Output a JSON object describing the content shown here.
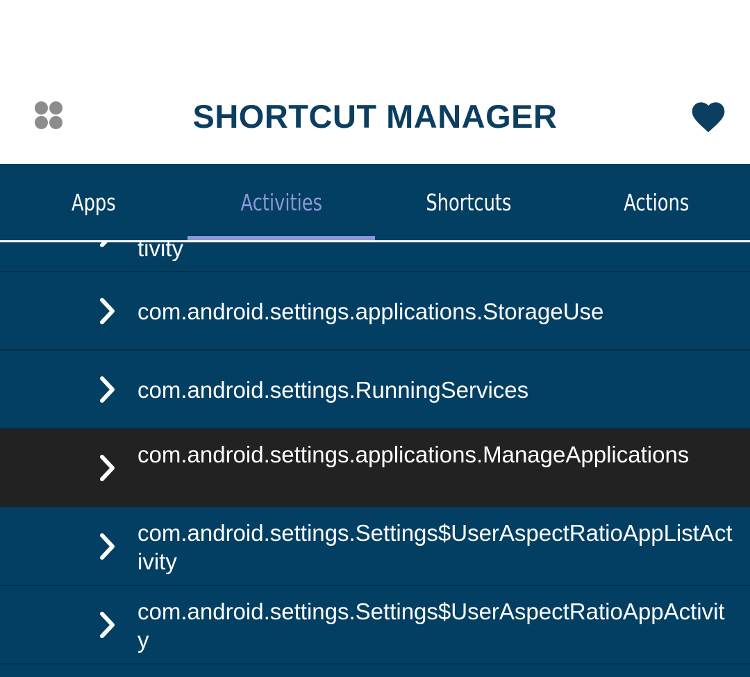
{
  "header": {
    "title": "SHORTCUT MANAGER",
    "menu_icon": "grid-dots-icon",
    "favorite_icon": "heart-icon"
  },
  "tabs": [
    {
      "label": "Apps",
      "active": false
    },
    {
      "label": "Activities",
      "active": true
    },
    {
      "label": "Shortcuts",
      "active": false
    },
    {
      "label": "Actions",
      "active": false
    }
  ],
  "list": {
    "items": [
      {
        "text": "tivity",
        "highlighted": false
      },
      {
        "text": "com.android.settings.applications.StorageUse",
        "highlighted": false
      },
      {
        "text": "com.android.settings.RunningServices",
        "highlighted": false
      },
      {
        "text": "com.android.settings.applications.ManageApplications",
        "highlighted": true
      },
      {
        "text": "com.android.settings.Settings$UserAspectRatioAppListActivity",
        "highlighted": false
      },
      {
        "text": "com.android.settings.Settings$UserAspectRatioAppActivity",
        "highlighted": false
      }
    ]
  },
  "colors": {
    "primary": "#033f63",
    "title": "#0b3e60",
    "active_tab": "#8b97d6",
    "highlight_row": "#222222"
  }
}
